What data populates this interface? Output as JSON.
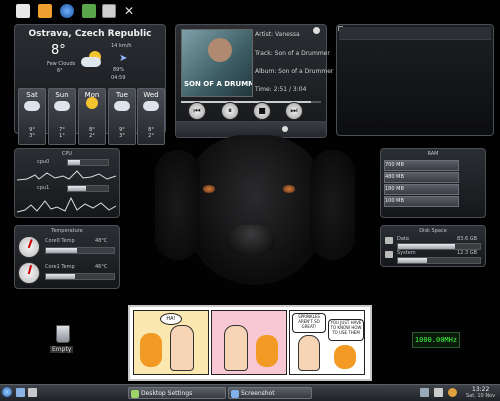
{
  "toolbar": {
    "icons": [
      "mail-icon",
      "folder-icon",
      "browser-icon",
      "recycle-icon",
      "terminal-icon",
      "tools-icon"
    ]
  },
  "weather": {
    "city": "Ostrava, Czech Republic",
    "temp": "8°",
    "condition": "Few Clouds",
    "feels": "6°",
    "wind": "14 km/h",
    "humidity": "89%",
    "time": "04:59",
    "days": [
      {
        "name": "Sat",
        "hi": "9°",
        "lo": "3°",
        "icon": "cloud"
      },
      {
        "name": "Sun",
        "hi": "7°",
        "lo": "1°",
        "icon": "cloud"
      },
      {
        "name": "Mon",
        "hi": "8°",
        "lo": "2°",
        "icon": "sun"
      },
      {
        "name": "Tue",
        "hi": "9°",
        "lo": "3°",
        "icon": "cloud"
      },
      {
        "name": "Wed",
        "hi": "8°",
        "lo": "2°",
        "icon": "cloud"
      }
    ]
  },
  "player": {
    "album_art_text": "SON OF A DRUMMER",
    "artist": "Artist: Vanessa",
    "track": "Track: Son of a Drummer",
    "album": "Album: Son of a Drummer",
    "time": "Time: 2:51 / 3:04",
    "progress": 0.93
  },
  "cpu": {
    "title": "CPU",
    "rows": [
      {
        "label": "cpu0",
        "load": 0.3
      },
      {
        "label": "cpu1",
        "load": 0.45
      }
    ]
  },
  "ram": {
    "title": "RAM",
    "rows": [
      "700 MB",
      "480 MB",
      "180 MB",
      "100 MB"
    ]
  },
  "temperature": {
    "title": "Temperature",
    "sensors": [
      {
        "label": "Core0 Temp",
        "value": "48°C",
        "level": 0.45
      },
      {
        "label": "Core1 Temp",
        "value": "46°C",
        "level": 0.42
      }
    ]
  },
  "disk": {
    "title": "Disk Space",
    "mounts": [
      {
        "label": "Data",
        "value": "83.6 GB",
        "level": 0.7
      },
      {
        "label": "System",
        "value": "12.3 GB",
        "level": 0.35
      }
    ]
  },
  "comic": {
    "bubble1": "HA!",
    "bubble2": "SPRINKLES AREN'T SO GREAT!",
    "bubble3": "YOU JUST HAVE TO KNOW HOW TO USE THEM"
  },
  "desktop": {
    "trash_label": "Empty",
    "cpu_freq": "1000.00MHz"
  },
  "taskbar": {
    "tasks": [
      "Desktop Settings",
      "Screenshot"
    ],
    "clock_time": "13:22",
    "clock_date": "Sat, 10 Nov"
  }
}
